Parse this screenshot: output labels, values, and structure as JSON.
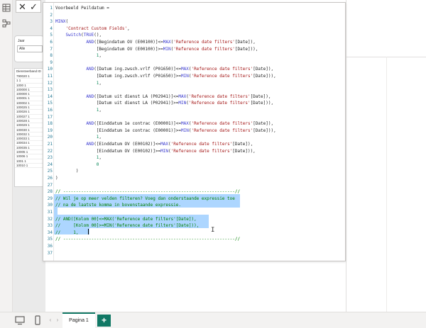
{
  "formula_bar": {
    "cancel_glyph": "✕",
    "commit_glyph": "✓"
  },
  "slicer": {
    "label": "Jaar",
    "value": "Alle"
  },
  "table": {
    "header": "Dienstverband ID",
    "rows": [
      "790020 1",
      "1 1",
      "1000 1",
      "100000 1",
      "100000 1",
      "100001 1",
      "100002 1",
      "100025 1",
      "100026 1",
      "100027 1",
      "100028 1",
      "100029 1",
      "100030 1",
      "100032 1",
      "100033 1",
      "100034 1",
      "100035 1",
      "10005 1",
      "10006 1",
      "1001 1",
      "10010 1"
    ]
  },
  "editor": {
    "lines": [
      {
        "n": "1",
        "text": "Voorbeeld Peildatum ="
      },
      {
        "n": "2",
        "text": ""
      },
      {
        "n": "3",
        "text": "MINX("
      },
      {
        "n": "4",
        "text": "    'Contract Custom Fields',"
      },
      {
        "n": "5",
        "text": "    Switch(TRUE(),"
      },
      {
        "n": "6",
        "text": "            AND([Begindatum OV (E00100)]<=MAX('Reference date filters'[Date]),"
      },
      {
        "n": "7",
        "text": "                [Begindatum OV (E00100)]>=MIN('Reference date filters'[Date])),"
      },
      {
        "n": "8",
        "text": "                1,"
      },
      {
        "n": "9",
        "text": ""
      },
      {
        "n": "10",
        "text": "            AND([Datum ing.zwsch.vrlf (P01650)]<=MAX('Reference date filters'[Date]),"
      },
      {
        "n": "11",
        "text": "                [Datum ing.zwsch.vrlf (P01650)]>=MIN('Reference date filters'[Date])),"
      },
      {
        "n": "12",
        "text": "                1,"
      },
      {
        "n": "13",
        "text": ""
      },
      {
        "n": "14",
        "text": "            AND([Datum uit dienst LA (P02941)]<=MAX('Reference date filters'[Date]),"
      },
      {
        "n": "15",
        "text": "                [Datum uit dienst LA (P02941)]>=MIN('Reference date filters'[Date])),"
      },
      {
        "n": "16",
        "text": "                1,"
      },
      {
        "n": "17",
        "text": ""
      },
      {
        "n": "18",
        "text": "            AND([Einddatum 1e contrac (E00001)]<=MAX('Reference date filters'[Date]),"
      },
      {
        "n": "19",
        "text": "                [Einddatum 1e contrac (E00001)]>=MIN('Reference date filters'[Date])),"
      },
      {
        "n": "20",
        "text": "                1,"
      },
      {
        "n": "21",
        "text": "            AND([Einddatum OV (E00102)]<=MAX('Reference date filters'[Date]),"
      },
      {
        "n": "22",
        "text": "                [Einddatum OV (E00102)]>=MIN('Reference date filters'[Date])),"
      },
      {
        "n": "23",
        "text": "                1,"
      },
      {
        "n": "24",
        "text": "                0"
      },
      {
        "n": "25",
        "text": "        )"
      },
      {
        "n": "26",
        "text": ")"
      },
      {
        "n": "27",
        "text": ""
      },
      {
        "n": "28",
        "text": "// -------------------------------------------------------------------//"
      },
      {
        "n": "29",
        "text": "// Wil je op meer velden filteren? Voeg dan onderstaande expressie toe"
      },
      {
        "n": "30",
        "text": "// na de laatste komma in bovenstaande expressie."
      },
      {
        "n": "31",
        "text": ""
      },
      {
        "n": "32",
        "text": "// AND([Kolom 00]<=MAX('Reference date filters'[Date]),"
      },
      {
        "n": "33",
        "text": "//     [Kolom 00]>=MIN('Reference date filters'[Date])),"
      },
      {
        "n": "34",
        "text": "//     1,"
      },
      {
        "n": "35",
        "text": "// -------------------------------------------------------------------//"
      },
      {
        "n": "36",
        "text": ""
      },
      {
        "n": "37",
        "text": ""
      }
    ]
  },
  "pagebar": {
    "tab_label": "Pagina 1",
    "add_label": "+"
  }
}
